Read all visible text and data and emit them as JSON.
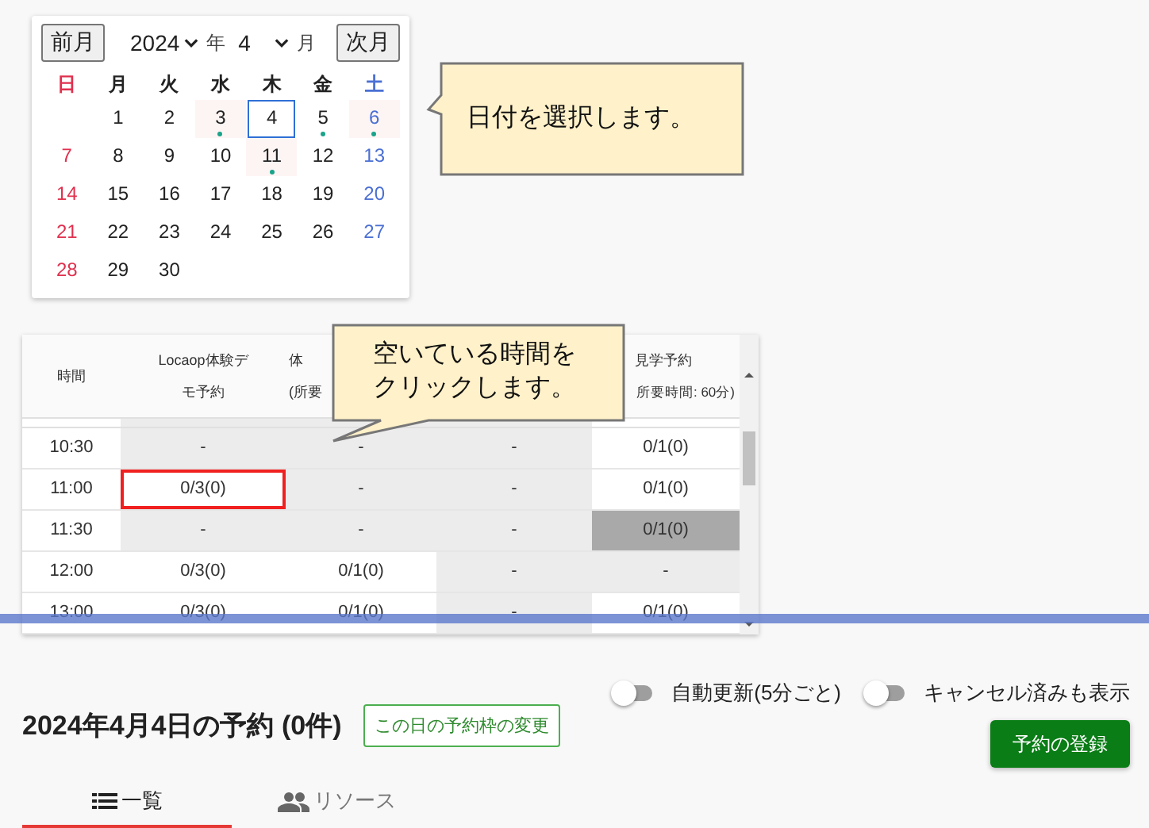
{
  "calendar": {
    "prev_button": "前月",
    "year": "2024",
    "year_label": "年",
    "month": "4",
    "month_label": "月",
    "next_button": "次月",
    "weekdays": [
      "日",
      "月",
      "火",
      "水",
      "木",
      "金",
      "土"
    ],
    "weeks": [
      [
        {
          "day": "1",
          "has_event": false,
          "tinted": false,
          "selected": false
        },
        {
          "day": "2",
          "has_event": false,
          "tinted": false,
          "selected": false
        },
        {
          "day": "3",
          "has_event": true,
          "tinted": true,
          "selected": false
        },
        {
          "day": "4",
          "has_event": false,
          "tinted": false,
          "selected": true
        },
        {
          "day": "5",
          "has_event": true,
          "tinted": false,
          "selected": false
        },
        {
          "day": "6",
          "has_event": true,
          "tinted": true,
          "selected": false
        }
      ],
      [
        {
          "day": "7",
          "has_event": false,
          "tinted": false,
          "selected": false
        },
        {
          "day": "8",
          "has_event": false,
          "tinted": false,
          "selected": false
        },
        {
          "day": "9",
          "has_event": false,
          "tinted": false,
          "selected": false
        },
        {
          "day": "10",
          "has_event": false,
          "tinted": false,
          "selected": false
        },
        {
          "day": "11",
          "has_event": true,
          "tinted": true,
          "selected": false
        },
        {
          "day": "12",
          "has_event": false,
          "tinted": false,
          "selected": false
        },
        {
          "day": "13",
          "has_event": false,
          "tinted": false,
          "selected": false
        }
      ],
      [
        {
          "day": "14",
          "has_event": false,
          "tinted": false,
          "selected": false
        },
        {
          "day": "15",
          "has_event": false,
          "tinted": false,
          "selected": false
        },
        {
          "day": "16",
          "has_event": false,
          "tinted": false,
          "selected": false
        },
        {
          "day": "17",
          "has_event": false,
          "tinted": false,
          "selected": false
        },
        {
          "day": "18",
          "has_event": false,
          "tinted": false,
          "selected": false
        },
        {
          "day": "19",
          "has_event": false,
          "tinted": false,
          "selected": false
        },
        {
          "day": "20",
          "has_event": false,
          "tinted": false,
          "selected": false
        }
      ],
      [
        {
          "day": "21",
          "has_event": false,
          "tinted": false,
          "selected": false
        },
        {
          "day": "22",
          "has_event": false,
          "tinted": false,
          "selected": false
        },
        {
          "day": "23",
          "has_event": false,
          "tinted": false,
          "selected": false
        },
        {
          "day": "24",
          "has_event": false,
          "tinted": false,
          "selected": false
        },
        {
          "day": "25",
          "has_event": false,
          "tinted": false,
          "selected": false
        },
        {
          "day": "26",
          "has_event": false,
          "tinted": false,
          "selected": false
        },
        {
          "day": "27",
          "has_event": false,
          "tinted": false,
          "selected": false
        }
      ],
      [
        {
          "day": "28",
          "has_event": false,
          "tinted": false,
          "selected": false
        },
        {
          "day": "29",
          "has_event": false,
          "tinted": false,
          "selected": false
        },
        {
          "day": "30",
          "has_event": false,
          "tinted": false,
          "selected": false
        }
      ]
    ]
  },
  "callouts": [
    {
      "text": "日付を選択します。"
    },
    {
      "text": "空いている時間をクリックします。"
    }
  ],
  "table": {
    "columns": [
      {
        "title": "時間"
      },
      {
        "title": "Locaop体験デモ予約"
      },
      {
        "title": "体",
        "subtitle": "(所要"
      },
      {},
      {
        "title": "見学予約",
        "subtitle": "所要時間: 60分)"
      }
    ],
    "rows": [
      {
        "cells": [
          {
            "text": "10:30"
          },
          {
            "text": "-",
            "available": false,
            "hovered": false,
            "highlighted": false
          },
          {
            "text": "-",
            "available": false,
            "hovered": false,
            "highlighted": false
          },
          {
            "text": "-",
            "available": false,
            "hovered": false,
            "highlighted": false
          },
          {
            "text": "0/1(0)",
            "available": true,
            "hovered": false,
            "highlighted": false
          }
        ]
      },
      {
        "cells": [
          {
            "text": "11:00"
          },
          {
            "text": "0/3(0)",
            "available": true,
            "hovered": false,
            "highlighted": true
          },
          {
            "text": "-",
            "available": false,
            "hovered": false,
            "highlighted": false
          },
          {
            "text": "-",
            "available": false,
            "hovered": false,
            "highlighted": false
          },
          {
            "text": "0/1(0)",
            "available": true,
            "hovered": false,
            "highlighted": false
          }
        ]
      },
      {
        "cells": [
          {
            "text": "11:30"
          },
          {
            "text": "-",
            "available": false,
            "hovered": false,
            "highlighted": false
          },
          {
            "text": "-",
            "available": false,
            "hovered": false,
            "highlighted": false
          },
          {
            "text": "-",
            "available": false,
            "hovered": false,
            "highlighted": false
          },
          {
            "text": "0/1(0)",
            "available": true,
            "hovered": true,
            "highlighted": false
          }
        ]
      },
      {
        "cells": [
          {
            "text": "12:00"
          },
          {
            "text": "0/3(0)",
            "available": true,
            "hovered": false,
            "highlighted": false
          },
          {
            "text": "0/1(0)",
            "available": true,
            "hovered": false,
            "highlighted": false
          },
          {
            "text": "-",
            "available": false,
            "hovered": false,
            "highlighted": false
          },
          {
            "text": "-",
            "available": false,
            "hovered": false,
            "highlighted": false
          }
        ]
      },
      {
        "cells": [
          {
            "text": "13:00"
          },
          {
            "text": "0/3(0)",
            "available": true,
            "hovered": false,
            "highlighted": false
          },
          {
            "text": "0/1(0)",
            "available": true,
            "hovered": false,
            "highlighted": false
          },
          {
            "text": "-",
            "available": false,
            "hovered": false,
            "highlighted": false
          },
          {
            "text": "0/1(0)",
            "available": true,
            "hovered": false,
            "highlighted": false
          }
        ]
      }
    ]
  },
  "reservations": {
    "title": "2024年4月4日の予約 (0件)",
    "change_button": "この日の予約枠の変更",
    "toggles": [
      {
        "label": "自動更新(5分ごと)",
        "on": false
      },
      {
        "label": "キャンセル済みも表示",
        "on": false
      }
    ],
    "register_button": "予約の登録",
    "tabs": [
      {
        "label": "一覧",
        "kind": "list",
        "selected": true
      },
      {
        "label": "リソース",
        "kind": "people",
        "selected": false
      }
    ]
  }
}
